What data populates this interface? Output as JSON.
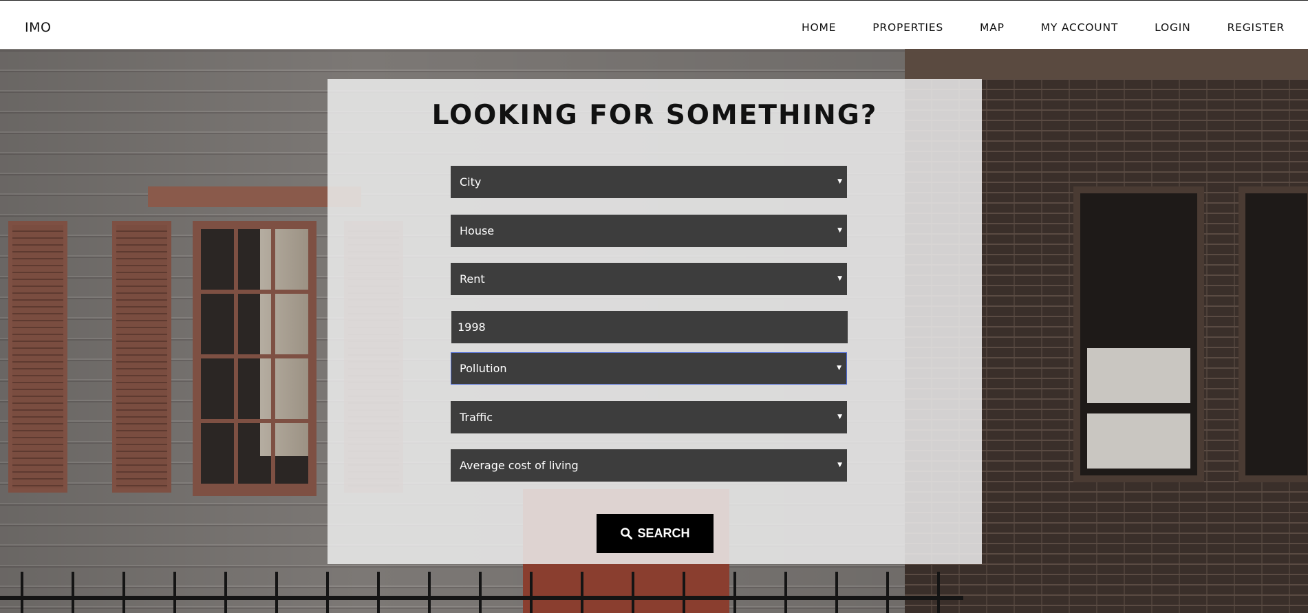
{
  "header": {
    "brand": "IMO",
    "nav": [
      {
        "label": "HOME"
      },
      {
        "label": "PROPERTIES"
      },
      {
        "label": "MAP"
      },
      {
        "label": "MY ACCOUNT"
      },
      {
        "label": "LOGIN"
      },
      {
        "label": "REGISTER"
      }
    ]
  },
  "search": {
    "title": "LOOKING FOR SOMETHING?",
    "city_select": "City",
    "type_select": "House",
    "offer_select": "Rent",
    "year_input_value": "1998",
    "pollution_select": "Pollution",
    "traffic_select": "Traffic",
    "cost_select": "Average cost of living",
    "button_label": "SEARCH",
    "button_icon": "search-icon"
  },
  "colors": {
    "field_bg": "#3d3d3d",
    "button_bg": "#000000",
    "focus_border": "#4d6ad6",
    "panel_bg": "rgba(236,236,236,0.86)"
  }
}
